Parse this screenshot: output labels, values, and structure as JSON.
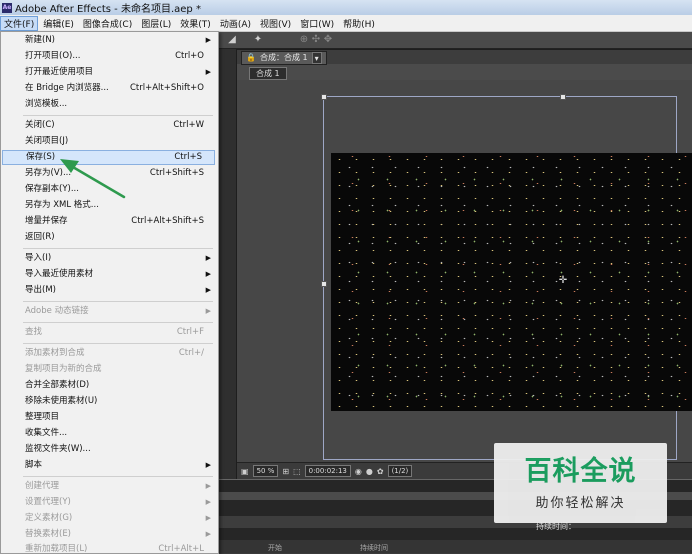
{
  "window": {
    "title": "Adobe After Effects - 未命名项目.aep *"
  },
  "menubar": {
    "items": [
      "文件(F)",
      "编辑(E)",
      "图像合成(C)",
      "图层(L)",
      "效果(T)",
      "动画(A)",
      "视图(V)",
      "窗口(W)",
      "帮助(H)"
    ]
  },
  "file_menu": {
    "new": "新建(N)",
    "open_project": "打开项目(O)...",
    "open_project_sc": "Ctrl+O",
    "open_recent": "打开最近使用项目",
    "browse_bridge": "在 Bridge 内浏览器...",
    "browse_bridge_sc": "Ctrl+Alt+Shift+O",
    "browse_templates": "浏览模板...",
    "close": "关闭(C)",
    "close_sc": "Ctrl+W",
    "close_project": "关闭项目(J)",
    "save": "保存(S)",
    "save_sc": "Ctrl+S",
    "save_as": "另存为(V)...",
    "save_as_sc": "Ctrl+Shift+S",
    "save_copy": "保存副本(Y)...",
    "save_xml": "另存为 XML 格式...",
    "increment_save": "增量并保存",
    "increment_save_sc": "Ctrl+Alt+Shift+S",
    "revert": "返回(R)",
    "import": "导入(I)",
    "import_recent": "导入最近使用素材",
    "export": "导出(M)",
    "dynamic_link": "Adobe 动态链接",
    "find": "查找",
    "find_sc": "Ctrl+F",
    "add_footage": "添加素材到合成",
    "add_footage_sc": "Ctrl+/",
    "new_comp_from": "复制项目为新的合成",
    "consolidate": "合并全部素材(D)",
    "remove_unused": "移除未使用素材(U)",
    "reduce_project": "整理项目",
    "collect_files": "收集文件...",
    "watch_folder": "监视文件夹(W)...",
    "scripts": "脚本",
    "create_proxy": "创建代理",
    "set_proxy": "设置代理(Y)",
    "interpret_footage": "定义素材(G)",
    "replace_footage": "替换素材(E)",
    "reload_footage": "重新加载项目(L)",
    "reload_footage_sc": "Ctrl+Alt+L"
  },
  "composition": {
    "tab_label": "合成：合成 1",
    "sub_tab": "合成 1",
    "zoom": "50 %",
    "timecode": "0:00:02:13",
    "resolution": "(1/2)"
  },
  "timeline": {
    "start_label": "开始",
    "duration_label": "持续时间",
    "time_label": "持续时间："
  },
  "watermark": {
    "line1": "百科全说",
    "line2": "助你轻松解决"
  },
  "colors": {
    "highlight": "#d5e6fb",
    "arrow": "#2e9a4e",
    "watermark_green": "#1aa260"
  }
}
